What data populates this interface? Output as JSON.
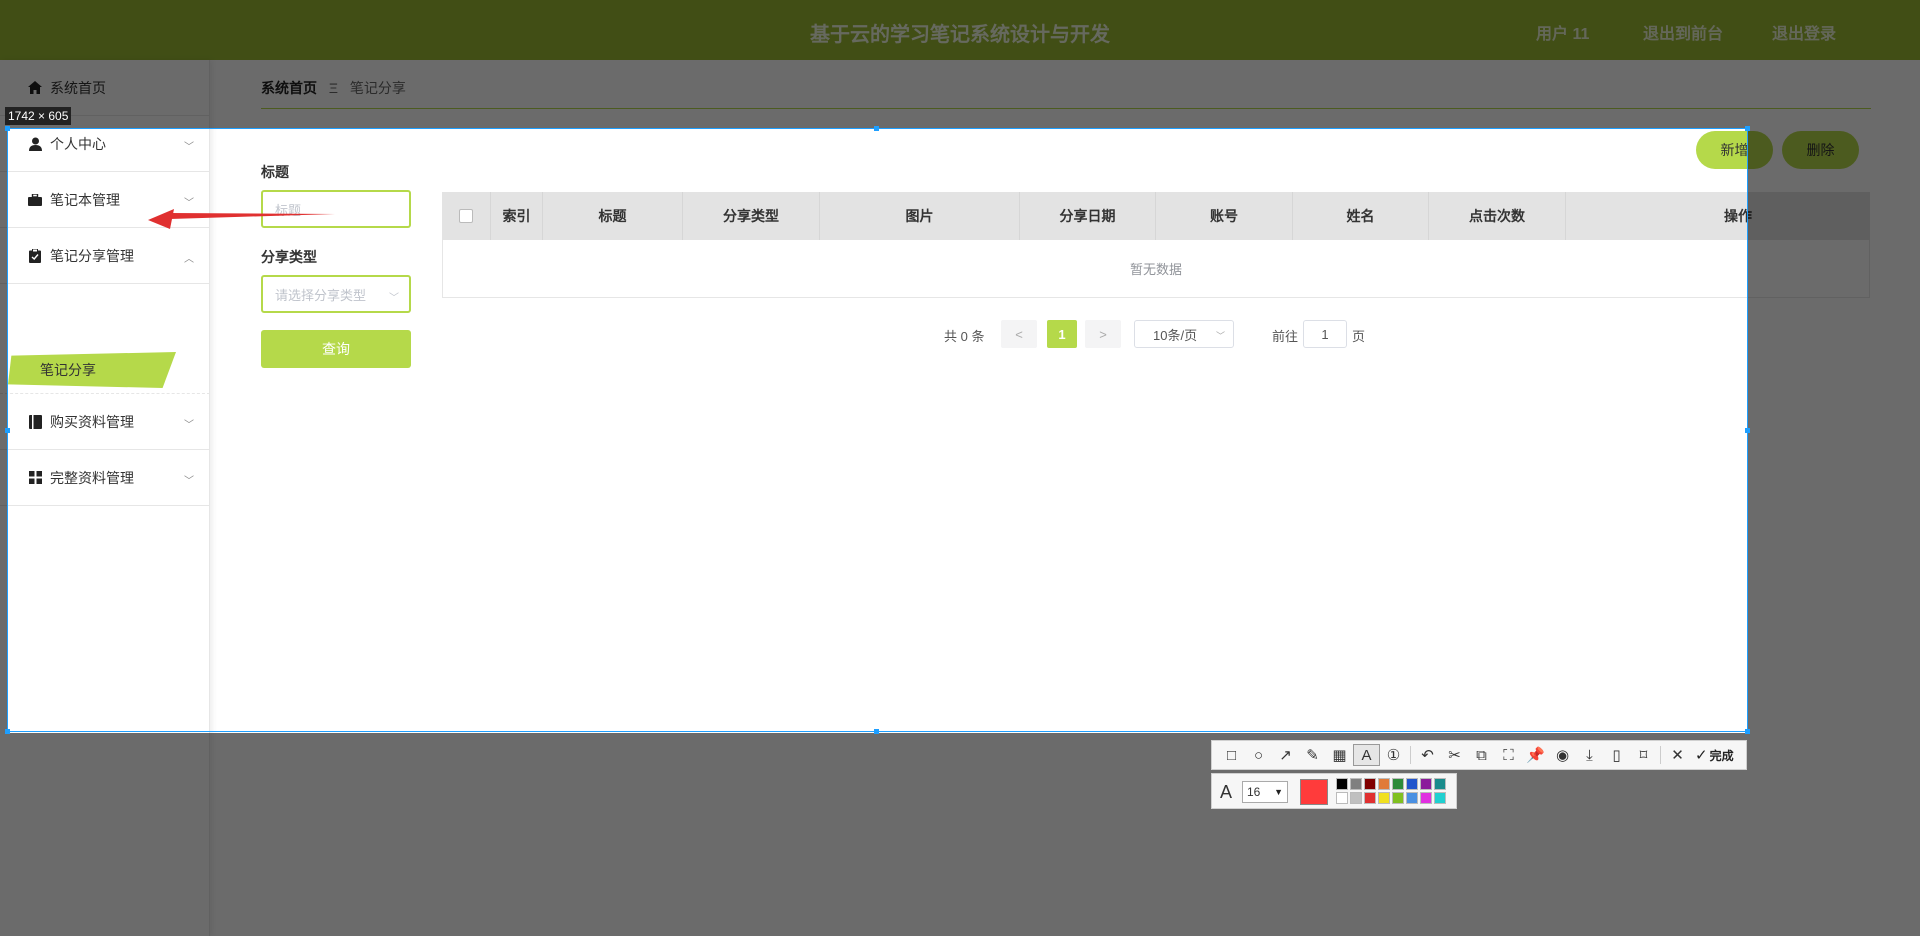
{
  "header": {
    "title": "基于云的学习笔记系统设计与开发",
    "user": "用户 11",
    "back_to_admin": "退出到前台",
    "logout": "退出登录"
  },
  "sidebar": {
    "home": "系统首页",
    "items": [
      {
        "label": "个人中心",
        "icon": "user-icon"
      },
      {
        "label": "笔记本管理",
        "icon": "briefcase-icon"
      },
      {
        "label": "笔记分享管理",
        "icon": "clipboard-icon"
      },
      {
        "label": "购买资料管理",
        "icon": "book-icon"
      },
      {
        "label": "完整资料管理",
        "icon": "grid-icon"
      }
    ],
    "active_sub": "笔记分享"
  },
  "breadcrumb": {
    "home": "系统首页",
    "separator": "Ξ",
    "current": "笔记分享"
  },
  "actions": {
    "add": "新增",
    "delete": "删除"
  },
  "search": {
    "title_label": "标题",
    "title_placeholder": "标题",
    "type_label": "分享类型",
    "type_placeholder": "请选择分享类型",
    "query": "查询"
  },
  "table": {
    "columns": [
      "索引",
      "标题",
      "分享类型",
      "图片",
      "分享日期",
      "账号",
      "姓名",
      "点击次数",
      "操作"
    ],
    "empty": "暂无数据"
  },
  "pagination": {
    "total": "共 0 条",
    "prev": "<",
    "current": "1",
    "next": ">",
    "page_size": "10条/页",
    "goto_prefix": "前往",
    "goto_value": "1",
    "goto_suffix": "页"
  },
  "capture": {
    "size_label": "1742 × 605",
    "font_size": "16",
    "done": "完成",
    "current_color": "#ff3b3b",
    "palette_top": [
      "#000000",
      "#808080",
      "#800000",
      "#e07b39",
      "#2e8b3a",
      "#2255cc",
      "#8b1a9b",
      "#1a8b8b"
    ],
    "palette_bottom": [
      "#ffffff",
      "#c0c0c0",
      "#e03030",
      "#f0e020",
      "#80c020",
      "#4a90e2",
      "#e030e0",
      "#20d0d0"
    ]
  },
  "colors": {
    "brand": "#9bba33",
    "accent": "#b5d94a",
    "capture_border": "#1e9fff"
  }
}
